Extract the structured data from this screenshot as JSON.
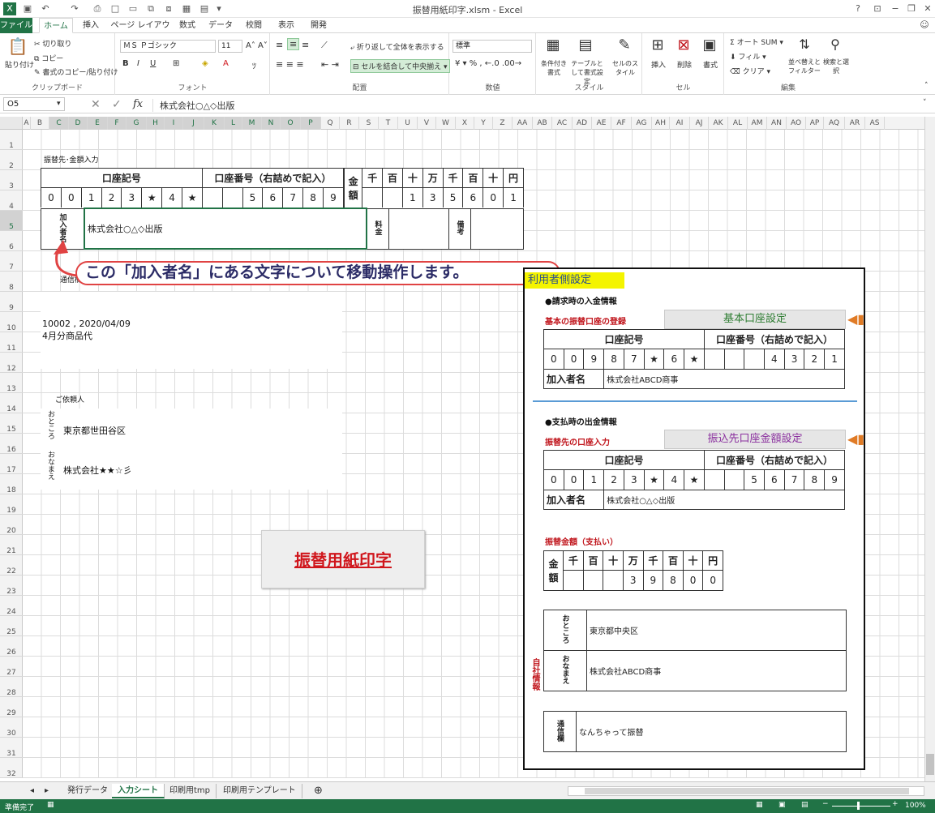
{
  "window": {
    "title": "振替用紙印字.xlsm - Excel"
  },
  "tabs": [
    "ファイル",
    "ホーム",
    "挿入",
    "ページ レイアウト",
    "数式",
    "データ",
    "校閲",
    "表示",
    "開発"
  ],
  "ribbon": {
    "clipboard": {
      "label": "クリップボード",
      "paste": "貼り付け",
      "cut": "切り取り",
      "copy": "コピー",
      "format_painter": "書式のコピー/貼り付け"
    },
    "font": {
      "label": "フォント",
      "name": "ＭＳ Ｐゴシック",
      "size": "11"
    },
    "alignment": {
      "label": "配置",
      "wrap": "折り返して全体を表示する",
      "merge": "セルを結合して中央揃え"
    },
    "number": {
      "label": "数値",
      "format": "標準"
    },
    "styles": {
      "label": "スタイル",
      "cond": "条件付き書式",
      "table": "テーブルとして書式設定",
      "cell": "セルのスタイル"
    },
    "cells": {
      "label": "セル",
      "insert": "挿入",
      "delete": "削除",
      "format": "書式"
    },
    "editing": {
      "label": "編集",
      "autosum": "オート SUM",
      "fill": "フィル",
      "clear": "クリア",
      "sort": "並べ替えとフィルター",
      "find": "検索と選択"
    }
  },
  "formula_bar": {
    "name_box": "O5",
    "fx": "fx",
    "content": "株式会社○△◇出版"
  },
  "columns": [
    "A",
    "B",
    "C",
    "D",
    "E",
    "F",
    "G",
    "H",
    "I",
    "J",
    "K",
    "L",
    "M",
    "N",
    "O",
    "P",
    "Q",
    "R",
    "S",
    "T",
    "U",
    "V",
    "W",
    "X",
    "Y",
    "Z",
    "AA",
    "AB",
    "AC",
    "AD",
    "AE",
    "AF",
    "AG",
    "AH",
    "AI",
    "AJ",
    "AK",
    "AL",
    "AM",
    "AN",
    "AO",
    "AP",
    "AQ",
    "AR",
    "AS"
  ],
  "rows": [
    "1",
    "2",
    "3",
    "4",
    "5",
    "6",
    "7",
    "8",
    "9",
    "10",
    "11",
    "12",
    "13",
    "14",
    "15",
    "16",
    "17",
    "18",
    "19",
    "20",
    "21",
    "22",
    "23",
    "24",
    "25",
    "26",
    "27",
    "28",
    "29",
    "30",
    "31",
    "32"
  ],
  "left": {
    "section_title": "振替先･金額入力",
    "acct_label": "口座記号",
    "acct_num_label": "口座番号（右詰めで記入）",
    "amount_label": "金額",
    "digit_heads": [
      "千",
      "百",
      "十",
      "万",
      "千",
      "百",
      "十",
      "円"
    ],
    "acct_digits": [
      "0",
      "0",
      "1",
      "2",
      "3",
      "★",
      "4",
      "★"
    ],
    "num_digits": [
      "",
      "",
      "5",
      "6",
      "7",
      "8",
      "9"
    ],
    "amount_digits": [
      "",
      "",
      "1",
      "3",
      "5",
      "6",
      "0",
      "1"
    ],
    "payee_label": "加入者名",
    "payee": "株式会社○△◇出版",
    "fee_label": "料金",
    "note_label": "備考",
    "comm_label": "通信欄",
    "comm_line1": "10002 , 2020/04/09",
    "comm_line2": "4月分商品代",
    "requester": "ご依頼人",
    "addr_label": "おところ",
    "addr": "東京都世田谷区",
    "name_label": "おなまえ",
    "name": "株式会社★★☆彡"
  },
  "callout": "この「加入者名」にある文字について移動操作します。",
  "print_button": "振替用紙印字",
  "panel": {
    "title": "利用者側設定",
    "recv_title": "●請求時の入金情報",
    "recv_sub": "基本の振替口座の登録",
    "recv_btn": "基本口座設定",
    "acct_label": "口座記号",
    "acct_num_label": "口座番号（右詰めで記入）",
    "recv_acct": [
      "0",
      "0",
      "9",
      "8",
      "7",
      "★",
      "6",
      "★"
    ],
    "recv_num": [
      "",
      "",
      "",
      "4",
      "3",
      "2",
      "1"
    ],
    "payee_label": "加入者名",
    "recv_payee": "株式会社ABCD商事",
    "pay_title": "●支払時の出金情報",
    "pay_sub": "振替先の口座入力",
    "pay_btn": "振込先口座金額設定",
    "pay_acct": [
      "0",
      "0",
      "1",
      "2",
      "3",
      "★",
      "4",
      "★"
    ],
    "pay_num": [
      "",
      "",
      "5",
      "6",
      "7",
      "8",
      "9"
    ],
    "pay_payee": "株式会社○△◇出版",
    "amount_title": "振替金額（支払い）",
    "amount_label": "金額",
    "digit_heads": [
      "千",
      "百",
      "十",
      "万",
      "千",
      "百",
      "十",
      "円"
    ],
    "amount_digits": [
      "",
      "",
      "",
      "3",
      "9",
      "8",
      "0",
      "0"
    ],
    "self_label": "自社情報",
    "addr_label": "おところ",
    "addr": "東京都中央区",
    "name_label": "おなまえ",
    "name": "株式会社ABCD商事",
    "comm_label": "通信欄",
    "comm": "なんちゃって振替"
  },
  "sheet_tabs": [
    "発行データ",
    "入力シート",
    "印刷用tmp",
    "印刷用テンプレート"
  ],
  "active_sheet": "入力シート",
  "status": {
    "ready": "準備完了",
    "zoom": "100%"
  },
  "colors": {
    "excel_green": "#217346",
    "callout_border": "#e04343",
    "red_text": "#c0141b",
    "green_text": "#2e7d32",
    "purple_text": "#8a2f9e",
    "arrow": "#e07b26",
    "divider": "#5a9bd5",
    "yellow": "#f4f400"
  }
}
